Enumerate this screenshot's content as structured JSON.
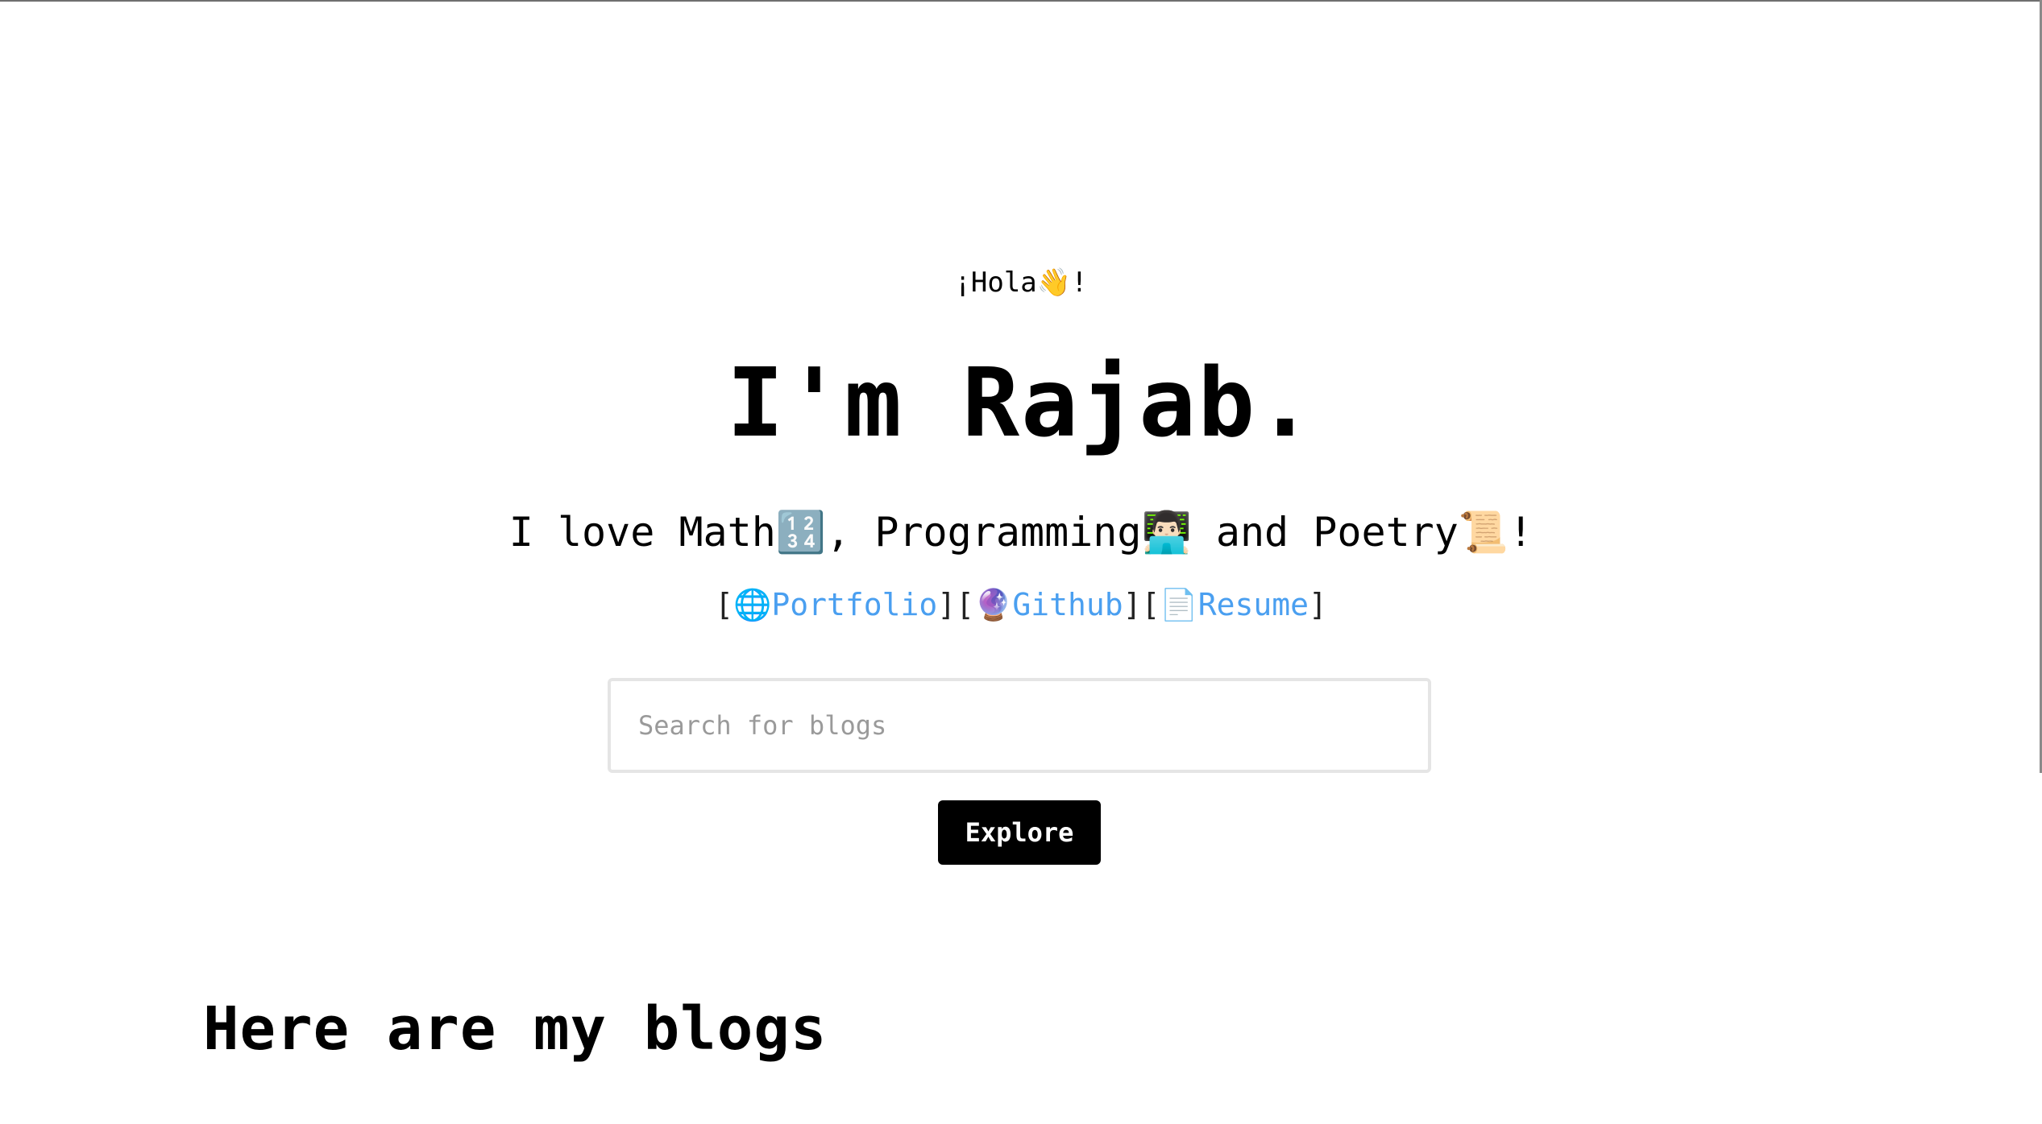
{
  "greeting": {
    "prefix": "¡Hola",
    "emoji": "👋",
    "suffix": "!"
  },
  "hero": {
    "title": "I'm Rajab."
  },
  "tagline": {
    "part1": "I love Math",
    "emoji1": "🔢",
    "part2": ", Programming",
    "emoji2": "👨🏻‍💻",
    "part3": " and Poetry",
    "emoji3": "📜",
    "part4": "!"
  },
  "links": [
    {
      "icon": "🌐",
      "label": "Portfolio"
    },
    {
      "icon": "🔮",
      "label": "Github"
    },
    {
      "icon": "📄",
      "label": "Resume"
    }
  ],
  "brackets": {
    "open": "[",
    "close": "]"
  },
  "search": {
    "placeholder": "Search for blogs",
    "value": ""
  },
  "explore_button": {
    "label": "Explore"
  },
  "blogs": {
    "heading": "Here are my blogs"
  },
  "colors": {
    "link": "#4a9ff0",
    "button_bg": "#000000",
    "button_text": "#ffffff",
    "input_border": "#e5e5e5"
  }
}
